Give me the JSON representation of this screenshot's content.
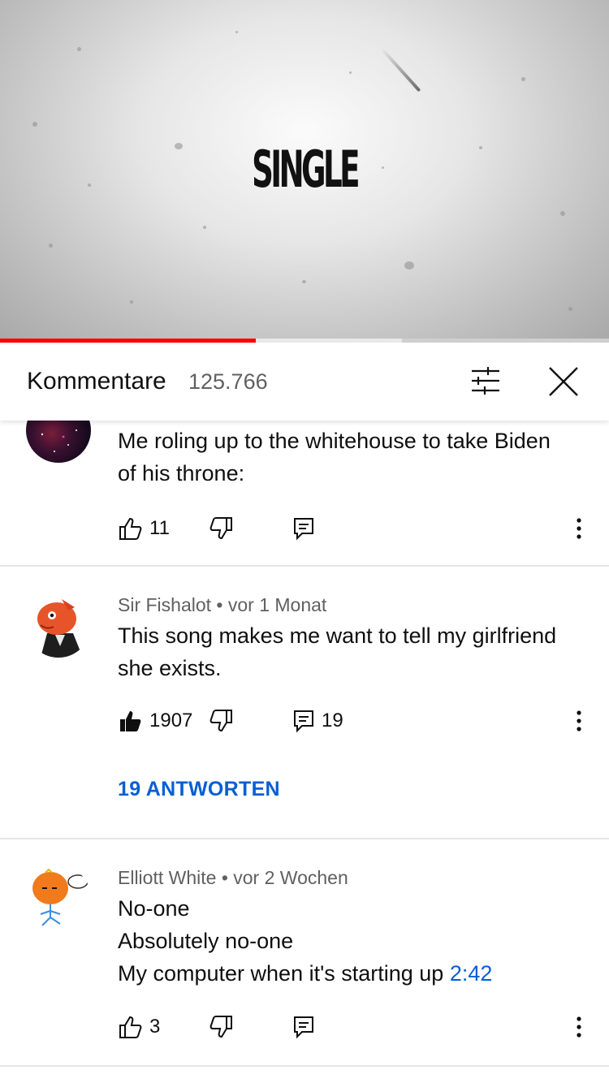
{
  "video": {
    "title_overlay": "SINGLE",
    "progress_percent": 42
  },
  "comments_header": {
    "title": "Kommentare",
    "count": "125.766",
    "icons": [
      "filter-sliders-icon",
      "close-icon"
    ]
  },
  "comments": [
    {
      "author": "",
      "meta": "",
      "lines": [
        "Me roling up to the whitehouse to take Biden",
        "of his throne:"
      ],
      "likes": "11",
      "liked": false,
      "reply_count": "",
      "replies_label": ""
    },
    {
      "author": "Sir Fishalot",
      "meta": "Sir Fishalot • vor 1 Monat",
      "lines": [
        "This song makes me want to tell my girlfriend",
        "she exists."
      ],
      "likes": "1907",
      "liked": true,
      "reply_count": "19",
      "replies_label": "19 ANTWORTEN"
    },
    {
      "author": "Elliott White",
      "meta": "Elliott White • vor 2 Wochen",
      "lines": [
        "No-one",
        "Absolutely no-one",
        "My computer when it's starting up "
      ],
      "timestamp": "2:42",
      "likes": "3",
      "liked": false,
      "reply_count": "",
      "replies_label": ""
    }
  ],
  "colors": {
    "accent_red": "#ff0000",
    "link_blue": "#065fd4",
    "secondary_text": "#606060"
  }
}
